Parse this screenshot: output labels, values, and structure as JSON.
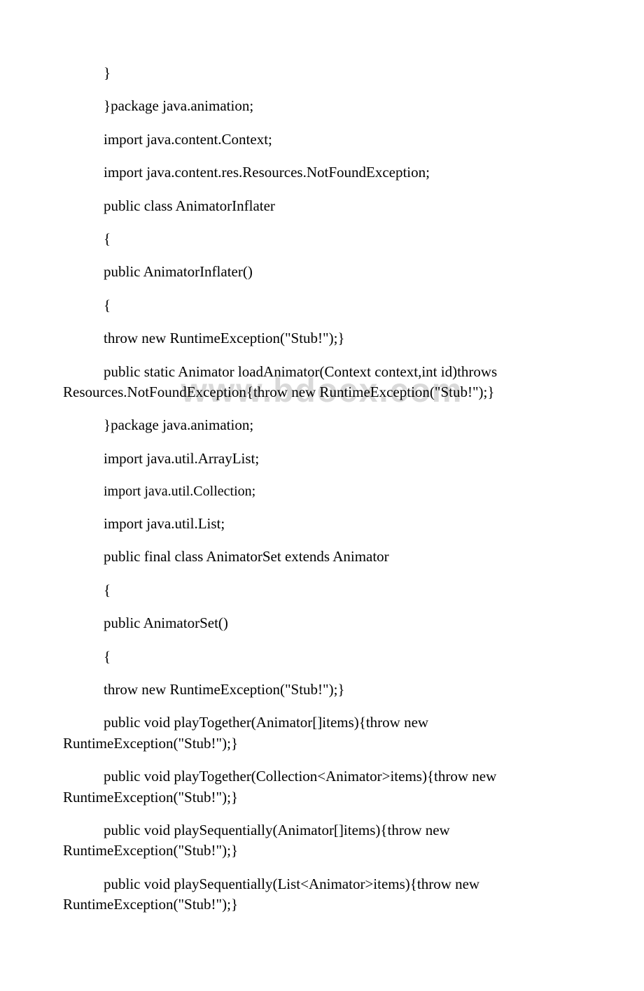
{
  "watermark": "www.bdocx.com",
  "lines": {
    "l1": "}",
    "l2": "}package java.animation;",
    "l3": "import java.content.Context;",
    "l4": "import java.content.res.Resources.NotFoundException;",
    "l5": "public class AnimatorInflater",
    "l6": "{",
    "l7": "public AnimatorInflater()",
    "l8": "{",
    "l9": "throw new RuntimeException(\"Stub!\");}",
    "l10a": "public static Animator loadAnimator(Context context,int id)throws",
    "l10b": "Resources.NotFoundException{throw new RuntimeException(\"Stub!\");}",
    "l11": "}package java.animation;",
    "l12": "import java.util.ArrayList;",
    "l13": "import java.util.Collection;",
    "l14": "import java.util.List;",
    "l15": "public final class AnimatorSet extends Animator",
    "l16": "{",
    "l17": "public AnimatorSet()",
    "l18": "{",
    "l19": "throw new RuntimeException(\"Stub!\");}",
    "l20a": "public void playTogether(Animator[]items){throw new",
    "l20b": "RuntimeException(\"Stub!\");}",
    "l21a": "public void playTogether(Collection<Animator>items){throw new",
    "l21b": "RuntimeException(\"Stub!\");}",
    "l22a": "public void playSequentially(Animator[]items){throw new",
    "l22b": "RuntimeException(\"Stub!\");}",
    "l23a": "public void playSequentially(List<Animator>items){throw new",
    "l23b": "RuntimeException(\"Stub!\");}"
  }
}
